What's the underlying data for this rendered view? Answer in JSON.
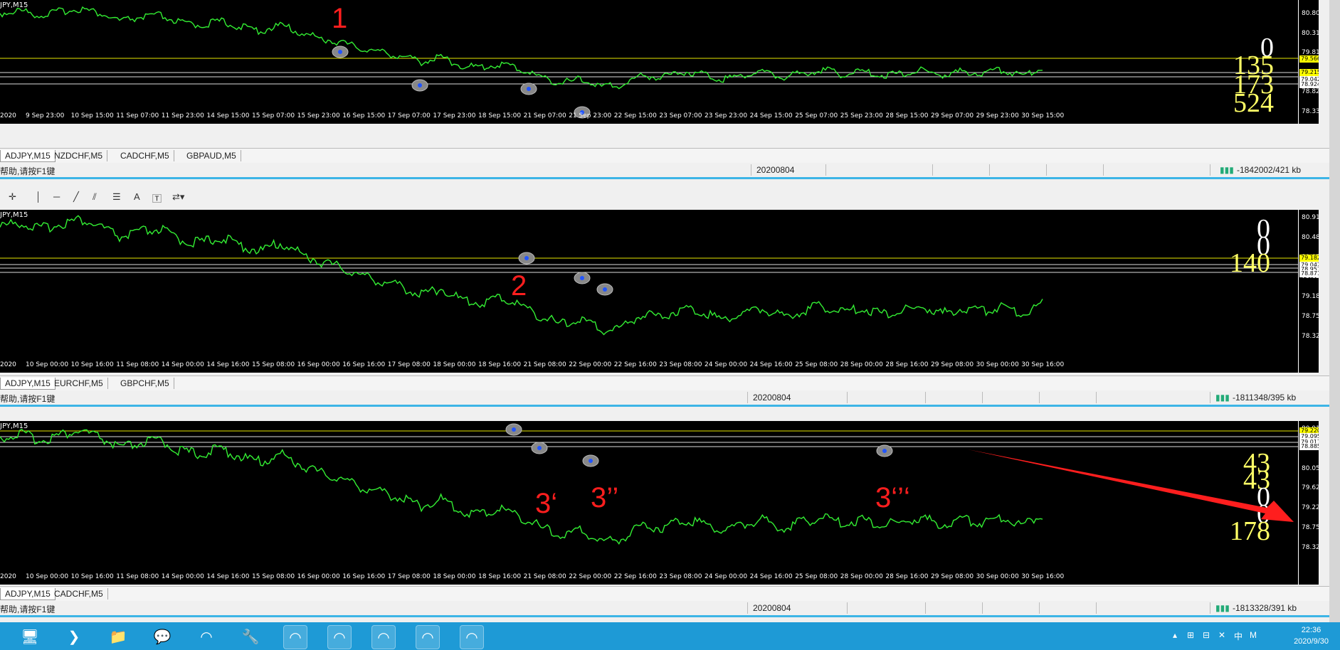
{
  "charts": [
    {
      "title": "JPY,M15",
      "yticks": [
        "80.800",
        "80.310",
        "79.810",
        "79.320",
        "78.820",
        "78.330"
      ],
      "price_labels": [
        {
          "text": "79.566",
          "bg": "#ffff00",
          "color": "#000"
        },
        {
          "text": "79.215",
          "bg": "#ffff00",
          "color": "#000"
        },
        {
          "text": "79.042",
          "bg": "#ffffff",
          "color": "#000"
        },
        {
          "text": "78.924",
          "bg": "#ffffff",
          "color": "#000"
        }
      ],
      "xlabels": [
        "2020",
        "9 Sep 23:00",
        "10 Sep 15:00",
        "11 Sep 07:00",
        "11 Sep 23:00",
        "14 Sep 15:00",
        "15 Sep 07:00",
        "15 Sep 23:00",
        "16 Sep 15:00",
        "17 Sep 07:00",
        "17 Sep 23:00",
        "18 Sep 15:00",
        "21 Sep 07:00",
        "21 Sep 23:00",
        "22 Sep 15:00",
        "23 Sep 07:00",
        "23 Sep 23:00",
        "24 Sep 15:00",
        "25 Sep 07:00",
        "25 Sep 23:00",
        "28 Sep 15:00",
        "29 Sep 07:00",
        "29 Sep 23:00",
        "30 Sep 15:00"
      ],
      "big_numbers": [
        {
          "text": "0",
          "color": "white"
        },
        {
          "text": "135",
          "color": "yellow"
        },
        {
          "text": "173",
          "color": "yellow"
        },
        {
          "text": "524",
          "color": "yellow"
        }
      ],
      "markers": [
        "1"
      ],
      "tabs": [
        "ADJPY,M15",
        "NZDCHF,M5",
        "CADCHF,M5",
        "GBPAUD,M5"
      ],
      "status_help": "帮助,请按F1键",
      "status_date": "20200804",
      "status_traffic": "-1842002/421 kb"
    },
    {
      "title": "JPY,M15",
      "yticks": [
        "80.910",
        "80.480",
        "80.050",
        "79.620",
        "79.182",
        "78.750",
        "78.320"
      ],
      "price_labels": [
        {
          "text": "79.182",
          "bg": "#ffff00",
          "color": "#000"
        },
        {
          "text": "79.042",
          "bg": "#ffffff",
          "color": "#000"
        },
        {
          "text": "78.957",
          "bg": "#ffffff",
          "color": "#000"
        },
        {
          "text": "78.871",
          "bg": "#ffffff",
          "color": "#000"
        }
      ],
      "xlabels": [
        "2020",
        "10 Sep 00:00",
        "10 Sep 16:00",
        "11 Sep 08:00",
        "14 Sep 00:00",
        "14 Sep 16:00",
        "15 Sep 08:00",
        "16 Sep 00:00",
        "16 Sep 16:00",
        "17 Sep 08:00",
        "18 Sep 00:00",
        "18 Sep 16:00",
        "21 Sep 08:00",
        "22 Sep 00:00",
        "22 Sep 16:00",
        "23 Sep 08:00",
        "24 Sep 00:00",
        "24 Sep 16:00",
        "25 Sep 08:00",
        "28 Sep 00:00",
        "28 Sep 16:00",
        "29 Sep 08:00",
        "30 Sep 00:00",
        "30 Sep 16:00"
      ],
      "big_numbers": [
        {
          "text": "0",
          "color": "white"
        },
        {
          "text": "0",
          "color": "white"
        },
        {
          "text": "140",
          "color": "yellow"
        }
      ],
      "markers": [
        "2"
      ],
      "tabs": [
        "ADJPY,M15",
        "EURCHF,M5",
        "GBPCHF,M5"
      ],
      "status_help": "帮助,请按F1键",
      "status_date": "20200804",
      "status_traffic": "-1811348/395 kb"
    },
    {
      "title": "JPY,M15",
      "yticks": [
        "80.910",
        "80.480",
        "80.050",
        "79.620",
        "79.220",
        "78.750",
        "78.320"
      ],
      "price_labels": [
        {
          "text": "79.220",
          "bg": "#ffff00",
          "color": "#000"
        },
        {
          "text": "79.095",
          "bg": "#ffffff",
          "color": "#000"
        },
        {
          "text": "79.017",
          "bg": "#ffffff",
          "color": "#000"
        },
        {
          "text": "78.885",
          "bg": "#ffffff",
          "color": "#000"
        }
      ],
      "xlabels": [
        "2020",
        "10 Sep 00:00",
        "10 Sep 16:00",
        "11 Sep 08:00",
        "14 Sep 00:00",
        "14 Sep 16:00",
        "15 Sep 08:00",
        "16 Sep 00:00",
        "16 Sep 16:00",
        "17 Sep 08:00",
        "18 Sep 00:00",
        "18 Sep 16:00",
        "21 Sep 08:00",
        "22 Sep 00:00",
        "22 Sep 16:00",
        "23 Sep 08:00",
        "24 Sep 00:00",
        "24 Sep 16:00",
        "25 Sep 08:00",
        "28 Sep 00:00",
        "28 Sep 16:00",
        "29 Sep 08:00",
        "30 Sep 00:00",
        "30 Sep 16:00"
      ],
      "big_numbers": [
        {
          "text": "43",
          "color": "yellow"
        },
        {
          "text": "43",
          "color": "yellow"
        },
        {
          "text": "0",
          "color": "white"
        },
        {
          "text": "0",
          "color": "white"
        },
        {
          "text": "178",
          "color": "yellow"
        }
      ],
      "markers": [
        "3‘",
        "3’’",
        "3‘’‘"
      ],
      "tabs": [
        "ADJPY,M15",
        "CADCHF,M5"
      ],
      "status_help": "帮助,请按F1键",
      "status_date": "20200804",
      "status_traffic": "-1813328/391 kb"
    }
  ],
  "taskbar": {
    "time": "22:36",
    "date": "2020/9/30",
    "ime": "中",
    "ime_mode": "M"
  }
}
